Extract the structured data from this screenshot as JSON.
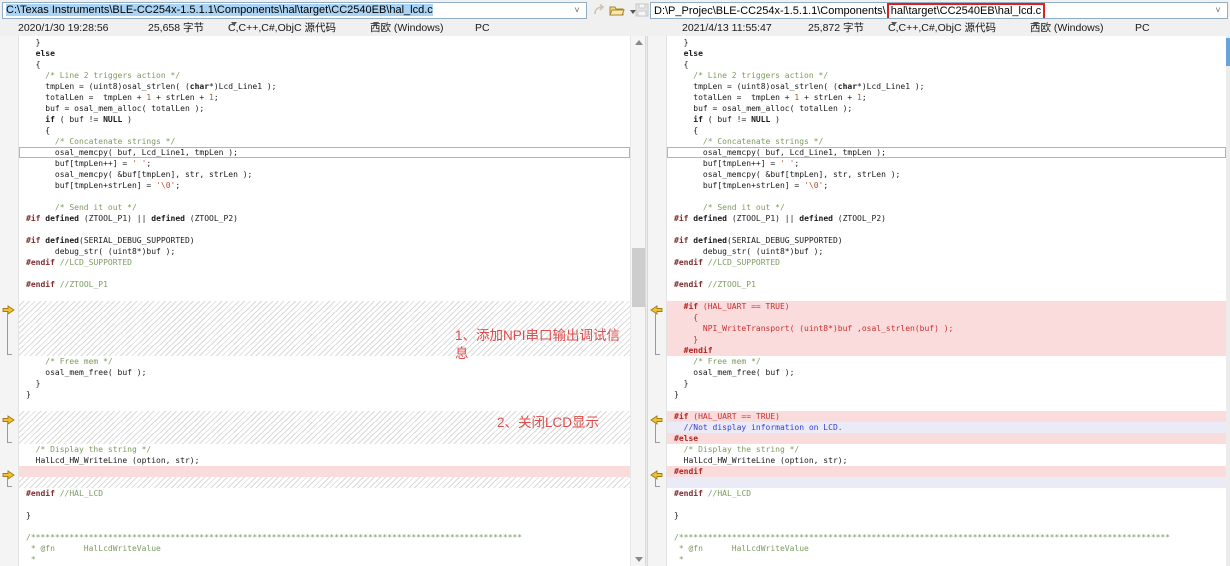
{
  "toolbar": {
    "left_path": "C:\\Texas Instruments\\BLE-CC254x-1.5.1.1\\Components\\hal\\target\\CC2540EB\\hal_lcd.c",
    "right_path_prefix": "D:\\P_Projec\\BLE-CC254x-1.5.1.1\\Components\\",
    "right_path_highlight": "hal\\target\\CC2540EB\\hal_lcd.c"
  },
  "left_info": {
    "modified": "2020/1/30 19:28:56",
    "size": "25,658 字节",
    "format": "C,C++,C#,ObjC 源代码",
    "encoding": "西欧 (Windows)",
    "line_ending": "PC"
  },
  "right_info": {
    "modified": "2021/4/13 11:55:47",
    "size": "25,872 字节",
    "format": "C,C++,C#,ObjC 源代码",
    "encoding": "西欧 (Windows)",
    "line_ending": "PC"
  },
  "annotations": {
    "note1": "1、添加NPI串口输出调试信息",
    "note2": "2、关闭LCD显示"
  },
  "colors": {
    "diff_important_bg": "#fbdcdc",
    "diff_important_text": "#c92f2f",
    "diff_unimportant_bg": "#ebebf7",
    "diff_unimportant_text": "#3b3bcf",
    "annotation_red": "#e04c4c",
    "comment_green": "#7d9b62",
    "marker_gold": "#f2c12e"
  },
  "left_lines": [
    {
      "t": "n",
      "c": "  }"
    },
    {
      "t": "n",
      "c": "  else"
    },
    {
      "t": "n",
      "c": "  {"
    },
    {
      "t": "n",
      "c": "    /* Line 2 triggers action */"
    },
    {
      "t": "n",
      "c": "    tmpLen = (uint8)osal_strlen( (char*)Lcd_Line1 );"
    },
    {
      "t": "n",
      "c": "    totalLen =  tmpLen + 1 + strLen + 1;"
    },
    {
      "t": "n",
      "c": "    buf = osal_mem_alloc( totalLen );"
    },
    {
      "t": "n",
      "c": "    if ( buf != NULL )"
    },
    {
      "t": "n",
      "c": "    {"
    },
    {
      "t": "n",
      "c": "      /* Concatenate strings */"
    },
    {
      "t": "b",
      "c": "      osal_memcpy( buf, Lcd_Line1, tmpLen );"
    },
    {
      "t": "n",
      "c": "      buf[tmpLen++] = ' ';"
    },
    {
      "t": "n",
      "c": "      osal_memcpy( &buf[tmpLen], str, strLen );"
    },
    {
      "t": "n",
      "c": "      buf[tmpLen+strLen] = '\\0';"
    },
    {
      "t": "n",
      "c": ""
    },
    {
      "t": "n",
      "c": "      /* Send it out */"
    },
    {
      "t": "n",
      "c": "#if defined (ZTOOL_P1) || defined (ZTOOL_P2)"
    },
    {
      "t": "n",
      "c": ""
    },
    {
      "t": "n",
      "c": "#if defined(SERIAL_DEBUG_SUPPORTED)"
    },
    {
      "t": "n",
      "c": "      debug_str( (uint8*)buf );"
    },
    {
      "t": "n",
      "c": "#endif //LCD_SUPPORTED"
    },
    {
      "t": "n",
      "c": ""
    },
    {
      "t": "n",
      "c": "#endif //ZTOOL_P1"
    },
    {
      "t": "n",
      "c": ""
    },
    {
      "t": "h",
      "c": ""
    },
    {
      "t": "h",
      "c": ""
    },
    {
      "t": "h",
      "c": ""
    },
    {
      "t": "h",
      "c": ""
    },
    {
      "t": "h",
      "c": ""
    },
    {
      "t": "n",
      "c": "    /* Free mem */"
    },
    {
      "t": "n",
      "c": "    osal_mem_free( buf );"
    },
    {
      "t": "n",
      "c": "  }"
    },
    {
      "t": "n",
      "c": "}"
    },
    {
      "t": "n",
      "c": ""
    },
    {
      "t": "h",
      "c": ""
    },
    {
      "t": "h",
      "c": ""
    },
    {
      "t": "h",
      "c": ""
    },
    {
      "t": "n",
      "c": "  /* Display the string */"
    },
    {
      "t": "n",
      "c": "  HalLcd_HW_WriteLine (option, str);"
    },
    {
      "t": "p",
      "c": ""
    },
    {
      "t": "h",
      "c": ""
    },
    {
      "t": "n",
      "c": "#endif //HAL_LCD"
    },
    {
      "t": "n",
      "c": ""
    },
    {
      "t": "n",
      "c": "}"
    },
    {
      "t": "n",
      "c": ""
    },
    {
      "t": "n",
      "c": "/******************************************************************************************************"
    },
    {
      "t": "n",
      "c": " * @fn      HalLcdWriteValue"
    },
    {
      "t": "n",
      "c": " *"
    }
  ],
  "right_lines": [
    {
      "t": "n",
      "c": "  }"
    },
    {
      "t": "n",
      "c": "  else"
    },
    {
      "t": "n",
      "c": "  {"
    },
    {
      "t": "n",
      "c": "    /* Line 2 triggers action */"
    },
    {
      "t": "n",
      "c": "    tmpLen = (uint8)osal_strlen( (char*)Lcd_Line1 );"
    },
    {
      "t": "n",
      "c": "    totalLen =  tmpLen + 1 + strLen + 1;"
    },
    {
      "t": "n",
      "c": "    buf = osal_mem_alloc( totalLen );"
    },
    {
      "t": "n",
      "c": "    if ( buf != NULL )"
    },
    {
      "t": "n",
      "c": "    {"
    },
    {
      "t": "n",
      "c": "      /* Concatenate strings */"
    },
    {
      "t": "b",
      "c": "      osal_memcpy( buf, Lcd_Line1, tmpLen );"
    },
    {
      "t": "n",
      "c": "      buf[tmpLen++] = ' ';"
    },
    {
      "t": "n",
      "c": "      osal_memcpy( &buf[tmpLen], str, strLen );"
    },
    {
      "t": "n",
      "c": "      buf[tmpLen+strLen] = '\\0';"
    },
    {
      "t": "n",
      "c": ""
    },
    {
      "t": "n",
      "c": "      /* Send it out */"
    },
    {
      "t": "n",
      "c": "#if defined (ZTOOL_P1) || defined (ZTOOL_P2)"
    },
    {
      "t": "n",
      "c": ""
    },
    {
      "t": "n",
      "c": "#if defined(SERIAL_DEBUG_SUPPORTED)"
    },
    {
      "t": "n",
      "c": "      debug_str( (uint8*)buf );"
    },
    {
      "t": "n",
      "c": "#endif //LCD_SUPPORTED"
    },
    {
      "t": "n",
      "c": ""
    },
    {
      "t": "n",
      "c": "#endif //ZTOOL_P1"
    },
    {
      "t": "n",
      "c": ""
    },
    {
      "t": "a",
      "c": "  #if (HAL_UART == TRUE)"
    },
    {
      "t": "a",
      "c": "    {"
    },
    {
      "t": "a",
      "c": "      NPI_WriteTransport( (uint8*)buf ,osal_strlen(buf) );"
    },
    {
      "t": "a",
      "c": "    }"
    },
    {
      "t": "a",
      "c": "  #endif"
    },
    {
      "t": "n",
      "c": "    /* Free mem */"
    },
    {
      "t": "n",
      "c": "    osal_mem_free( buf );"
    },
    {
      "t": "n",
      "c": "  }"
    },
    {
      "t": "n",
      "c": "}"
    },
    {
      "t": "n",
      "c": ""
    },
    {
      "t": "a",
      "c": "#if (HAL_UART == TRUE)"
    },
    {
      "t": "u",
      "c": "  //Not display information on LCD."
    },
    {
      "t": "a",
      "c": "#else"
    },
    {
      "t": "n",
      "c": "  /* Display the string */"
    },
    {
      "t": "n",
      "c": "  HalLcd_HW_WriteLine (option, str);"
    },
    {
      "t": "a",
      "c": "#endif"
    },
    {
      "t": "u",
      "c": ""
    },
    {
      "t": "n",
      "c": "#endif //HAL_LCD"
    },
    {
      "t": "n",
      "c": ""
    },
    {
      "t": "n",
      "c": "}"
    },
    {
      "t": "n",
      "c": ""
    },
    {
      "t": "n",
      "c": "/******************************************************************************************************"
    },
    {
      "t": "n",
      "c": " * @fn      HalLcdWriteValue"
    },
    {
      "t": "n",
      "c": " *"
    }
  ],
  "left_markers": [
    {
      "row": 24,
      "span": 5
    },
    {
      "row": 34,
      "span": 3
    },
    {
      "row": 39,
      "span": 2
    }
  ],
  "right_markers": [
    {
      "row": 24,
      "span": 5
    },
    {
      "row": 34,
      "span": 3
    },
    {
      "row": 39,
      "span": 2
    }
  ]
}
